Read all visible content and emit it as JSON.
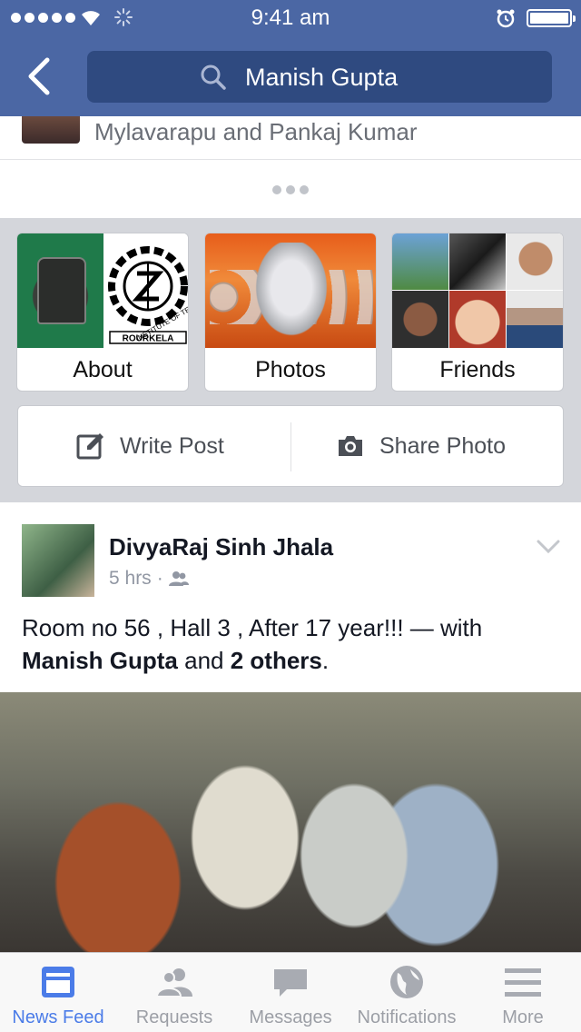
{
  "status_bar": {
    "time": "9:41 am"
  },
  "nav": {
    "search_query": "Manish Gupta"
  },
  "top": {
    "names_text": "Mylavarapu and Pankaj Kumar"
  },
  "tiles": [
    {
      "label": "About"
    },
    {
      "label": "Photos"
    },
    {
      "label": "Friends"
    }
  ],
  "about_logo_text": {
    "top": "INSTITUTE OF TE",
    "bottom": "ROURKELA"
  },
  "actions": {
    "write_post": "Write Post",
    "share_photo": "Share Photo"
  },
  "post": {
    "author": "DivyaRaj Sinh Jhala",
    "time": "5 hrs",
    "audience_icon": "friends-icon",
    "text_main": "Room no 56 , Hall 3 , After 17 year!!! — with",
    "tagged_1": "Manish Gupta",
    "and_word": " and ",
    "tagged_2": "2 others",
    "end": "."
  },
  "tabs": [
    {
      "label": "News Feed",
      "icon": "news-feed-icon",
      "active": true
    },
    {
      "label": "Requests",
      "icon": "requests-icon"
    },
    {
      "label": "Messages",
      "icon": "messages-icon"
    },
    {
      "label": "Notifications",
      "icon": "globe-icon"
    },
    {
      "label": "More",
      "icon": "menu-icon"
    }
  ],
  "colors": {
    "brand": "#4b67a4",
    "active_tab": "#4b7ce8"
  }
}
